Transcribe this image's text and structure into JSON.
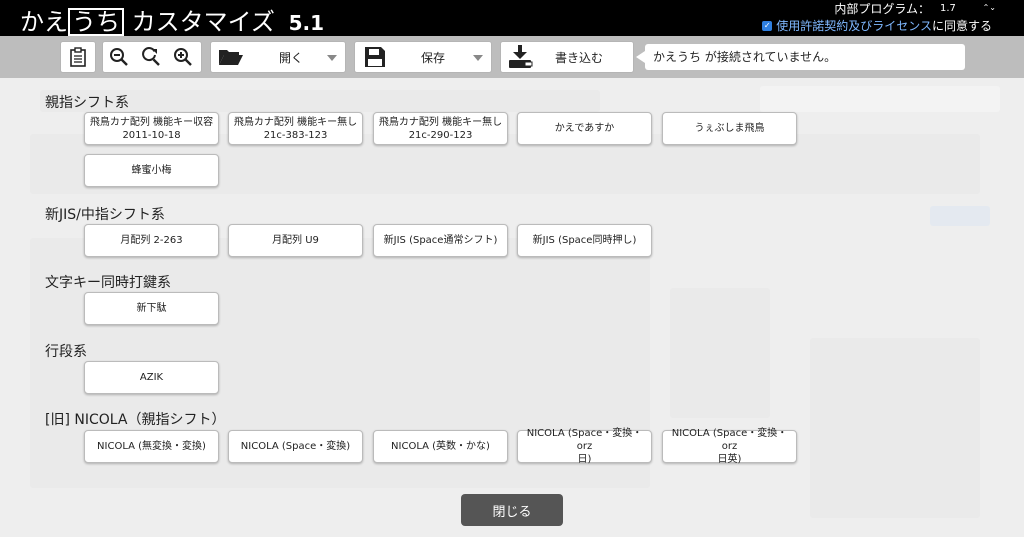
{
  "titlebar": {
    "app_name_prefix": "かえ",
    "app_name_logo": "うち",
    "app_name_suffix": " カスタマイズ",
    "version": "5.1",
    "firmware_label": "内部プログラム：",
    "firmware_value": "1.7",
    "firmware_caret": "⌃⌄",
    "license_check": "✓",
    "license_link": "使用許諾契約及びライセンス",
    "license_suffix": "に同意する"
  },
  "toolbar": {
    "open_label": "開く",
    "save_label": "保存",
    "write_label": "書き込む",
    "status": "かえうち が接続されていません。"
  },
  "dialog": {
    "sections": [
      {
        "title": "親指シフト系",
        "items": [
          {
            "label": "飛鳥カナ配列 機能キー収容\n2011-10-18"
          },
          {
            "label": "飛鳥カナ配列 機能キー無し\n21c-383-123"
          },
          {
            "label": "飛鳥カナ配列 機能キー無し\n21c-290-123"
          },
          {
            "label": "かえであすか"
          },
          {
            "label": "うぇぶしま飛鳥"
          },
          {
            "label": "蜂蜜小梅"
          }
        ]
      },
      {
        "title": "新JIS/中指シフト系",
        "items": [
          {
            "label": "月配列 2-263"
          },
          {
            "label": "月配列 U9"
          },
          {
            "label": "新JIS (Space通常シフト)"
          },
          {
            "label": "新JIS (Space同時押し)"
          }
        ]
      },
      {
        "title": "文字キー同時打鍵系",
        "items": [
          {
            "label": "新下駄"
          }
        ]
      },
      {
        "title": "行段系",
        "items": [
          {
            "label": "AZIK"
          }
        ]
      },
      {
        "title": "[旧] NICOLA（親指シフト）",
        "items": [
          {
            "label": "NICOLA (無変換・変換)"
          },
          {
            "label": "NICOLA (Space・変換)"
          },
          {
            "label": "NICOLA (英数・かな)"
          },
          {
            "label": "NICOLA (Space・変換・orz\n日)"
          },
          {
            "label": "NICOLA (Space・変換・orz\n日英)"
          }
        ]
      }
    ],
    "close_label": "閉じる"
  }
}
